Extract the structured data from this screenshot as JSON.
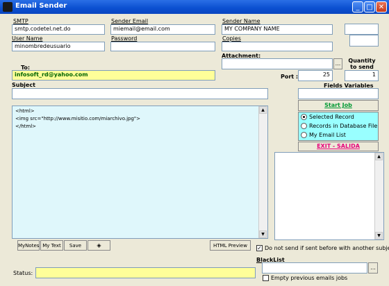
{
  "window": {
    "title": "Email Sender"
  },
  "fields": {
    "smtp": {
      "label": "SMTP",
      "value": "smtp.codetel.net.do"
    },
    "sender_email": {
      "label": "Sender Email",
      "value": "miemail@email.com"
    },
    "sender_name": {
      "label": "Sender Name",
      "value": "MY COMPANY NAME"
    },
    "user_name": {
      "label": "User Name",
      "value": "minombredeusuario"
    },
    "password": {
      "label": "Password",
      "value": ""
    },
    "copies": {
      "label": "Copies",
      "value": ""
    },
    "attachment": {
      "label": "Attachment:",
      "value": "",
      "browse": "..."
    },
    "quantity": {
      "label": "Quantity to send",
      "value": "1"
    },
    "to": {
      "label": "To:",
      "value": "infosoft_rd@yahoo.com"
    },
    "port": {
      "label": "Port :",
      "value": "25"
    },
    "subject": {
      "label": "Subject",
      "value": ""
    },
    "fields_variables": {
      "label": "Fields Variables",
      "value": ""
    }
  },
  "body_text": "<html>\n<img src=\"http://www.misitio.com/miarchivo.jpg\">\n</html>",
  "buttons": {
    "start_job": "Start Job",
    "exit": "EXIT - SALIDA",
    "my_notes": "MyNotes",
    "my_text": "My Text",
    "save": "Save",
    "html_preview": "HTML Preview",
    "blacklist_browse": "..."
  },
  "options": [
    {
      "label": "Selected Record",
      "selected": true
    },
    {
      "label": "Records in Database File",
      "selected": false
    },
    {
      "label": "My Email List",
      "selected": false
    }
  ],
  "do_not_send": {
    "label": "Do not send if sent before with another subjec",
    "checked": true
  },
  "status": {
    "label": "Status:",
    "value": ""
  },
  "blacklist": {
    "label": "BlackList",
    "value": ""
  },
  "empty_previous": {
    "label": "Empty previous emails jobs",
    "checked": false
  },
  "colors": {
    "highlight_yellow": "#ffff99",
    "cyan_panel": "#99ffff",
    "body_bg": "#dff7fb",
    "exit_color": "#e5007a",
    "start_green": "#009933"
  }
}
